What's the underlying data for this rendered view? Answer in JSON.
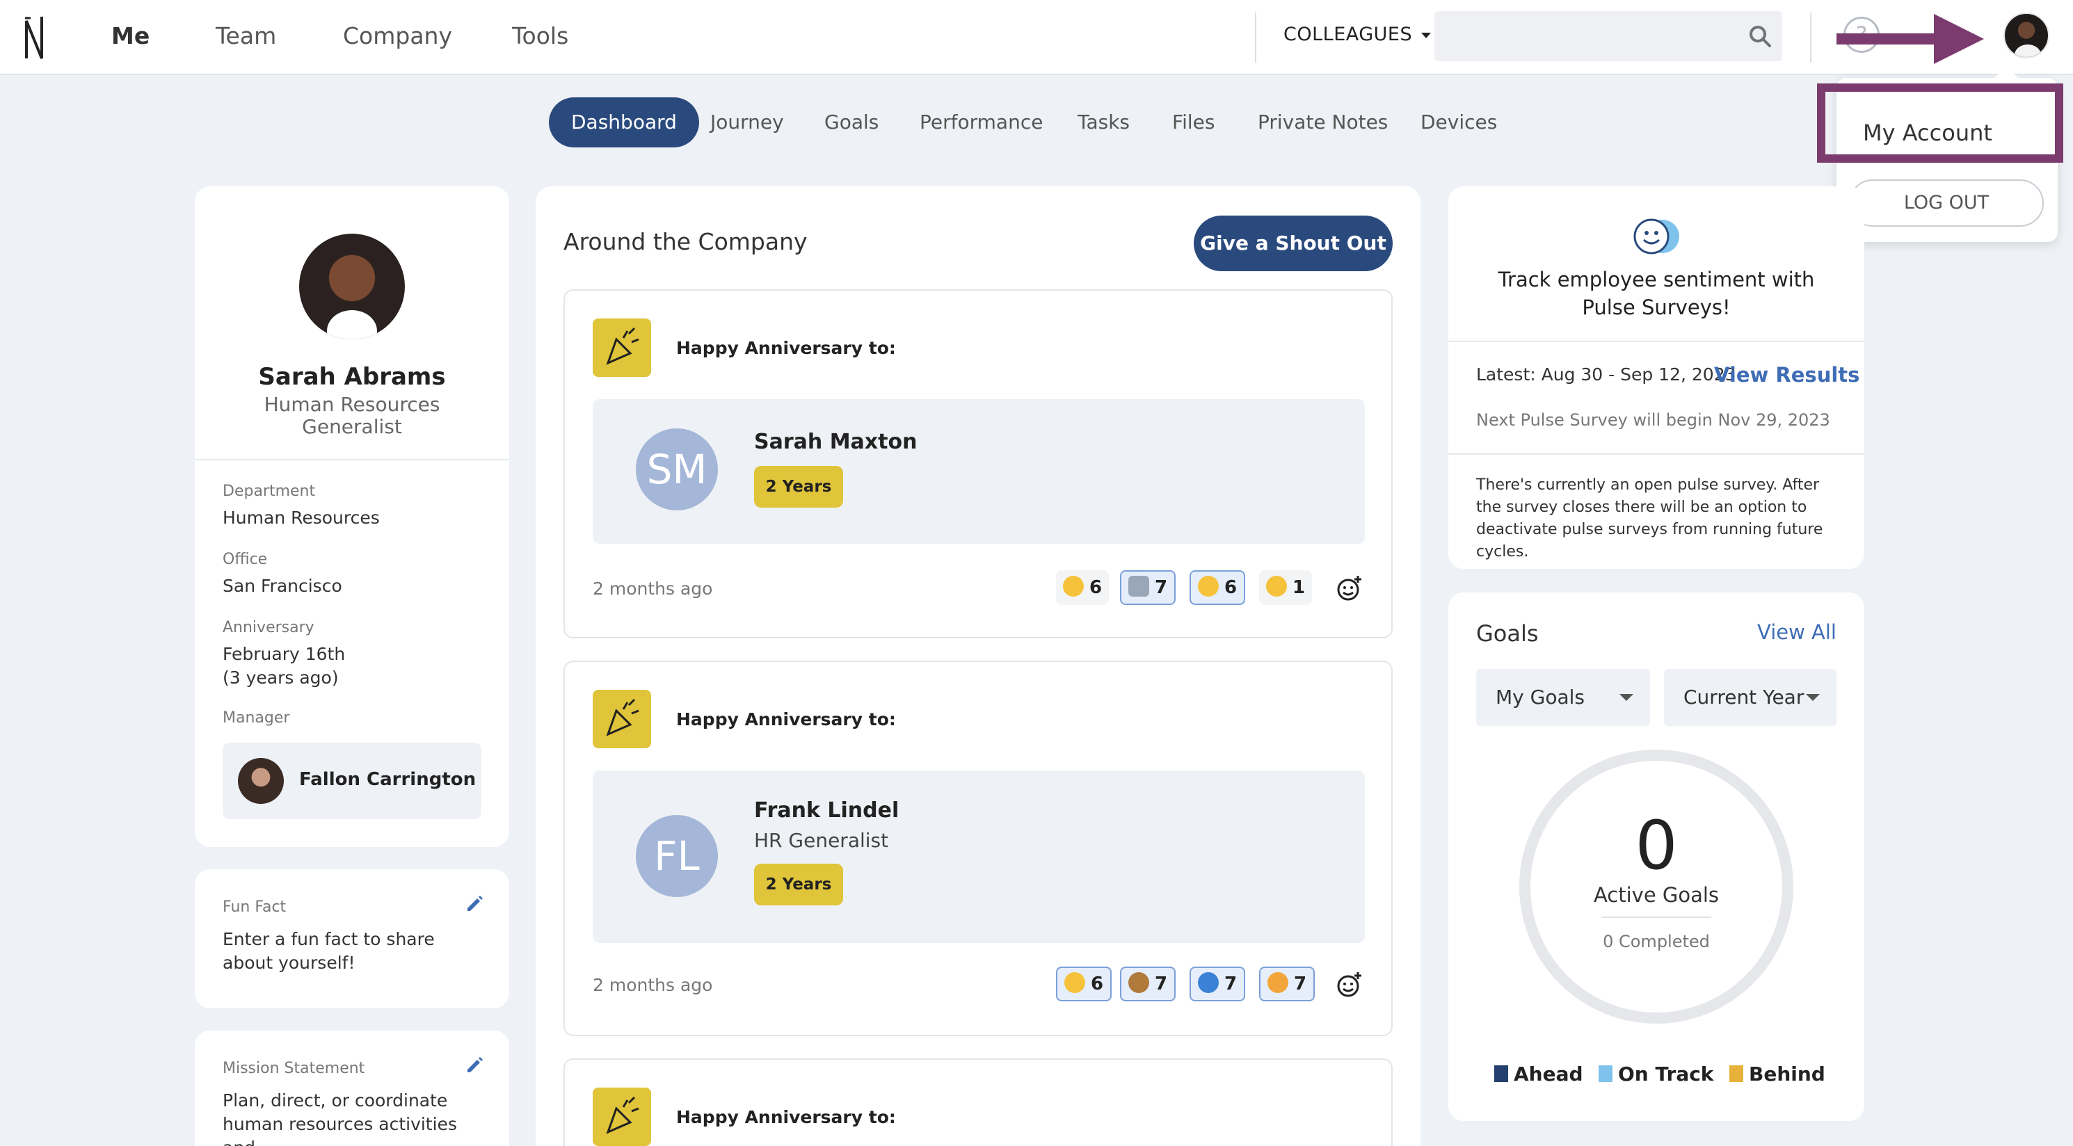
{
  "colors": {
    "primary": "#2a4a7d",
    "accent_yellow": "#e0c43a",
    "link": "#3e6db5",
    "highlight": "#7b3b6f"
  },
  "nav": {
    "items": [
      "Me",
      "Team",
      "Company",
      "Tools"
    ],
    "colleagues_label": "COLLEAGUES",
    "search_placeholder": ""
  },
  "account_menu": {
    "my_account": "My Account",
    "logout": "LOG OUT"
  },
  "tabs": [
    "Dashboard",
    "Journey",
    "Goals",
    "Performance",
    "Tasks",
    "Files",
    "Private Notes",
    "Devices"
  ],
  "profile": {
    "name": "Sarah Abrams",
    "title": "Human Resources Generalist",
    "department_label": "Department",
    "department": "Human Resources",
    "office_label": "Office",
    "office": "San Francisco",
    "anniversary_label": "Anniversary",
    "anniversary": "February 16th",
    "anniversary_ago": "(3 years ago)",
    "manager_label": "Manager",
    "manager": "Fallon Carrington"
  },
  "fun_fact": {
    "label": "Fun Fact",
    "text": "Enter a fun fact to share about yourself!"
  },
  "mission": {
    "label": "Mission Statement",
    "text": "Plan, direct, or coordinate human resources activities and"
  },
  "feed": {
    "title": "Around the Company",
    "shout_button": "Give a Shout Out",
    "posts": [
      {
        "heading": "Happy Anniversary to:",
        "initials": "SM",
        "name": "Sarah Maxton",
        "role": "",
        "years": "2 Years",
        "time": "2 months ago",
        "reactions": [
          {
            "icon": "raised-hands",
            "count": "6"
          },
          {
            "icon": "robot",
            "count": "7"
          },
          {
            "icon": "heart-hands",
            "count": "6"
          },
          {
            "icon": "hugging-face",
            "count": "1"
          }
        ]
      },
      {
        "heading": "Happy Anniversary to:",
        "initials": "FL",
        "name": "Frank Lindel",
        "role": "HR Generalist",
        "years": "2 Years",
        "time": "2 months ago",
        "reactions": [
          {
            "icon": "clapping-hands",
            "count": "6"
          },
          {
            "icon": "cowboy-face",
            "count": "7"
          },
          {
            "icon": "blue-heart",
            "count": "7"
          },
          {
            "icon": "cat-face",
            "count": "7"
          }
        ]
      },
      {
        "heading": "Happy Anniversary to:"
      }
    ]
  },
  "pulse": {
    "title": "Track employee sentiment with Pulse Surveys!",
    "latest": "Latest: Aug 30 - Sep 12, 2023",
    "view_results": "View Results",
    "next": "Next Pulse Survey will begin Nov 29, 2023",
    "description": "There's currently an open pulse survey. After the survey closes there will be an option to deactivate pulse surveys from running future cycles."
  },
  "goals": {
    "title": "Goals",
    "view_all": "View All",
    "filter_owner": "My Goals",
    "filter_period": "Current Year",
    "active_count": "0",
    "active_label": "Active Goals",
    "completed": "0 Completed",
    "legend": [
      {
        "label": "Ahead",
        "color": "#24406e"
      },
      {
        "label": "On Track",
        "color": "#7fc3ec"
      },
      {
        "label": "Behind",
        "color": "#e8b23a"
      }
    ]
  }
}
